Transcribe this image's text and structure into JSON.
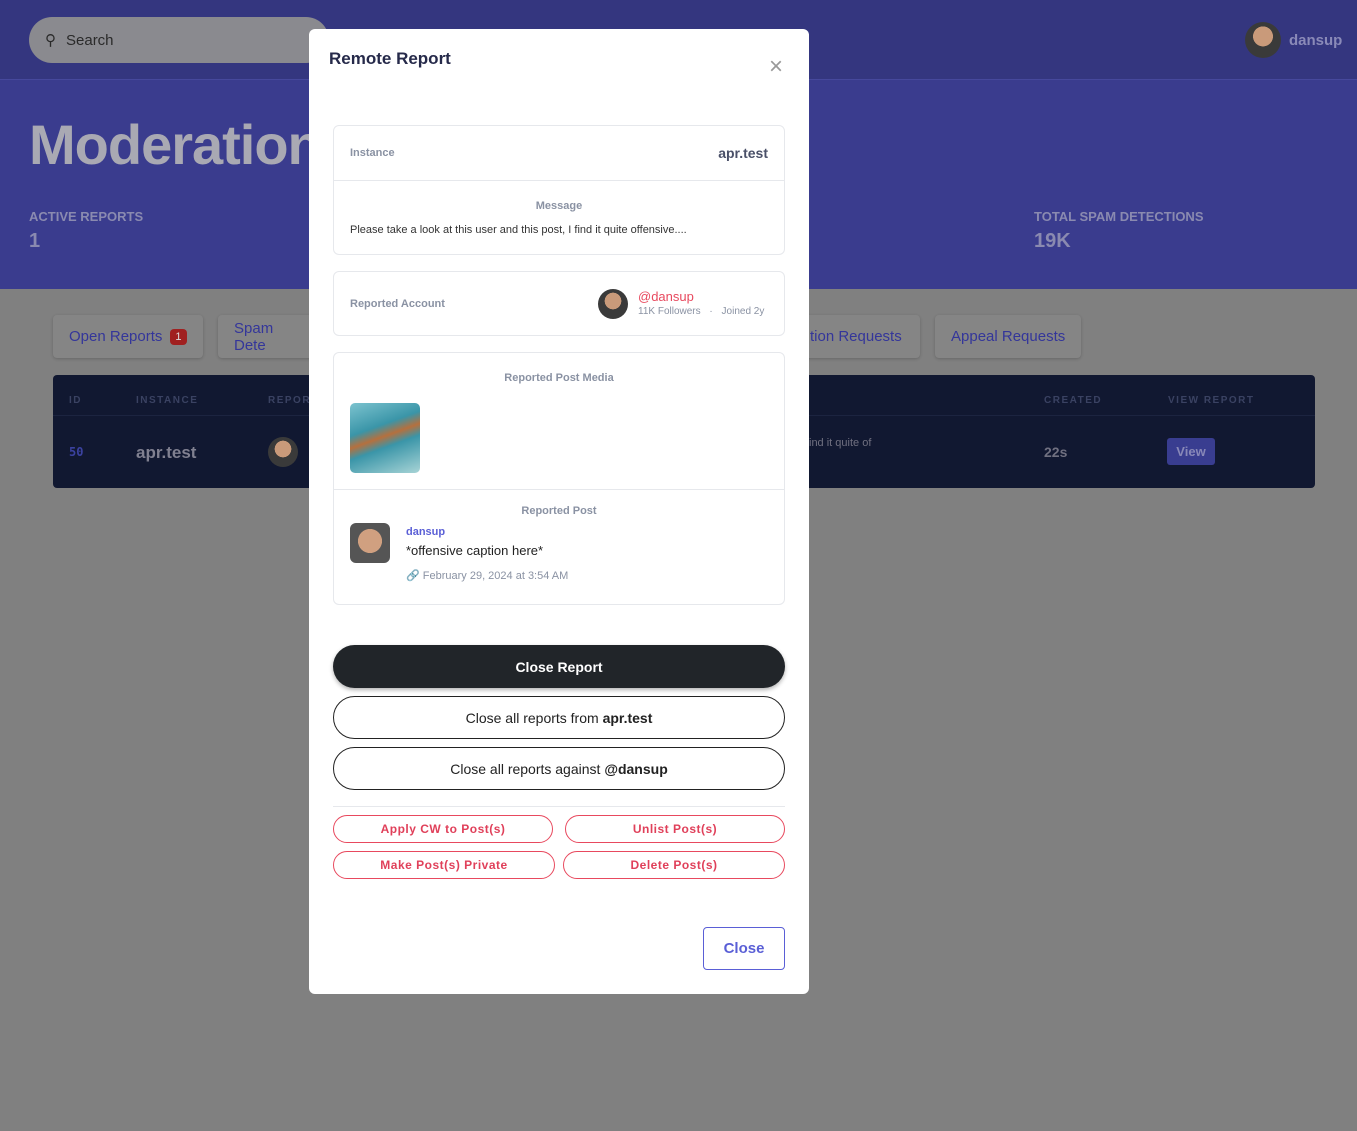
{
  "header": {
    "search_placeholder": "Search",
    "username": "dansup",
    "title": "Moderation",
    "stats": [
      {
        "label": "ACTIVE REPORTS",
        "value": "1"
      },
      {
        "label": "TOTAL SPAM DETECTIONS",
        "value": "19K"
      }
    ]
  },
  "tabs": [
    {
      "label": "Open Reports",
      "badge": "1"
    },
    {
      "label": "Spam Dete"
    },
    {
      "label": "tion Requests"
    },
    {
      "label": "Appeal Requests"
    }
  ],
  "table": {
    "headers": [
      "ID",
      "INSTANCE",
      "REPOR",
      "CREATED",
      "VIEW REPORT"
    ],
    "row": {
      "id": "50",
      "instance": "apr.test",
      "message_fragment": "ind it quite of",
      "created": "22s",
      "view": "View"
    }
  },
  "modal": {
    "title": "Remote Report",
    "close_icon": "×",
    "instance_label": "Instance",
    "instance_value": "apr.test",
    "message_label": "Message",
    "message": "Please take a look at this user and this post, I find it quite offensive....",
    "account_label": "Reported Account",
    "account_handle": "@dansup",
    "followers": "11K Followers",
    "dot": "·",
    "joined": "Joined 2y",
    "media_label": "Reported Post Media",
    "post_label": "Reported Post",
    "post_user": "dansup",
    "post_caption": "*offensive caption here*",
    "post_date": "February 29, 2024 at 3:54 AM",
    "close_report": "Close Report",
    "close_from_prefix": "Close all reports from ",
    "close_from_target": "apr.test",
    "close_against_prefix": "Close all reports against ",
    "close_against_target": "@dansup",
    "actions": [
      "Apply CW to Post(s)",
      "Unlist Post(s)",
      "Make Post(s) Private",
      "Delete Post(s)"
    ],
    "close": "Close"
  },
  "colors": {
    "accent": "#5a5fd6",
    "danger": "#e8495e",
    "dark": "#212529"
  }
}
